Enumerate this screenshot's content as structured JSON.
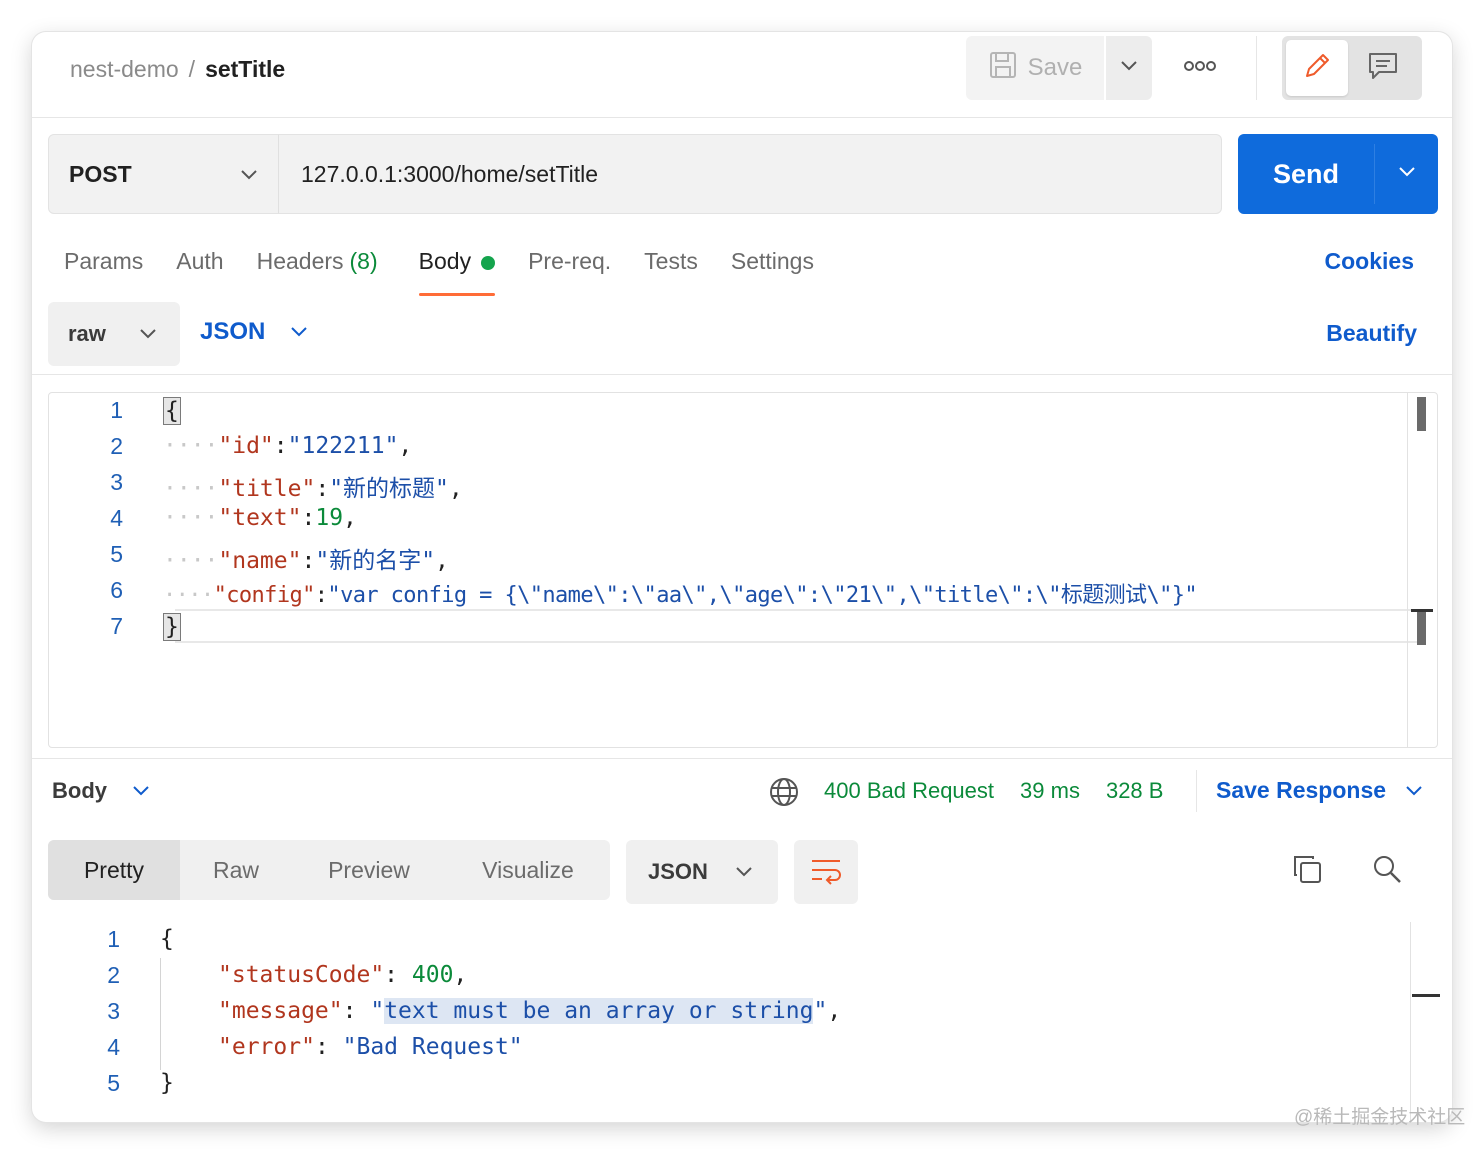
{
  "header": {
    "collection": "nest-demo",
    "separator": "/",
    "request_name": "setTitle",
    "save_label": "Save",
    "more_icon": "ooo"
  },
  "request": {
    "method": "POST",
    "url": "127.0.0.1:3000/home/setTitle",
    "send_label": "Send"
  },
  "tabs": {
    "items": [
      {
        "label": "Params"
      },
      {
        "label": "Auth"
      },
      {
        "label": "Headers",
        "count": "(8)"
      },
      {
        "label": "Body",
        "active": true
      },
      {
        "label": "Pre-req."
      },
      {
        "label": "Tests"
      },
      {
        "label": "Settings"
      }
    ],
    "cookies_label": "Cookies"
  },
  "body_options": {
    "mode": "raw",
    "format": "JSON",
    "beautify_label": "Beautify"
  },
  "request_body": {
    "line_numbers": [
      "1",
      "2",
      "3",
      "4",
      "5",
      "6",
      "7"
    ],
    "lines": [
      {
        "open": "{"
      },
      {
        "key": "\"id\"",
        "colon": ":",
        "value": "\"122211\"",
        "trail": ","
      },
      {
        "key": "\"title\"",
        "colon": ":",
        "value": "\"新的标题\"",
        "trail": ","
      },
      {
        "key": "\"text\"",
        "colon": ":",
        "value": "19",
        "trail": ","
      },
      {
        "key": "\"name\"",
        "colon": ":",
        "value": "\"新的名字\"",
        "trail": ","
      },
      {
        "key": "\"config\"",
        "colon": ":",
        "value": "\"var config = {\\\"name\\\":\\\"aa\\\",\\\"age\\\":\\\"21\\\",\\\"title\\\":\\\"标题测试\\\"}\"",
        "trail": ""
      },
      {
        "close": "}"
      }
    ]
  },
  "response": {
    "view_label": "Body",
    "status": "400 Bad Request",
    "time": "39 ms",
    "size": "328 B",
    "save_response_label": "Save Response",
    "view_tabs": [
      "Pretty",
      "Raw",
      "Preview",
      "Visualize"
    ],
    "format": "JSON",
    "line_numbers": [
      "1",
      "2",
      "3",
      "4",
      "5"
    ],
    "open": "{",
    "close": "}",
    "entries": [
      {
        "key": "\"statusCode\"",
        "value": "400",
        "type": "number",
        "trail": ","
      },
      {
        "key": "\"message\"",
        "value_quote": "\"",
        "value_text": "text must be an array or string",
        "value_end": "\"",
        "type": "string",
        "trail": ","
      },
      {
        "key": "\"error\"",
        "value": "\"Bad Request\"",
        "type": "string",
        "trail": ""
      }
    ]
  },
  "watermark": "@稀土掘金技术社区",
  "colors": {
    "send": "#0f6bdc",
    "active_tab_underline": "#ff6c37",
    "link": "#0f5bcc",
    "status_ok_green": "#0b8a3a",
    "json_key": "#b1361e",
    "json_string": "#1c4fa8"
  }
}
